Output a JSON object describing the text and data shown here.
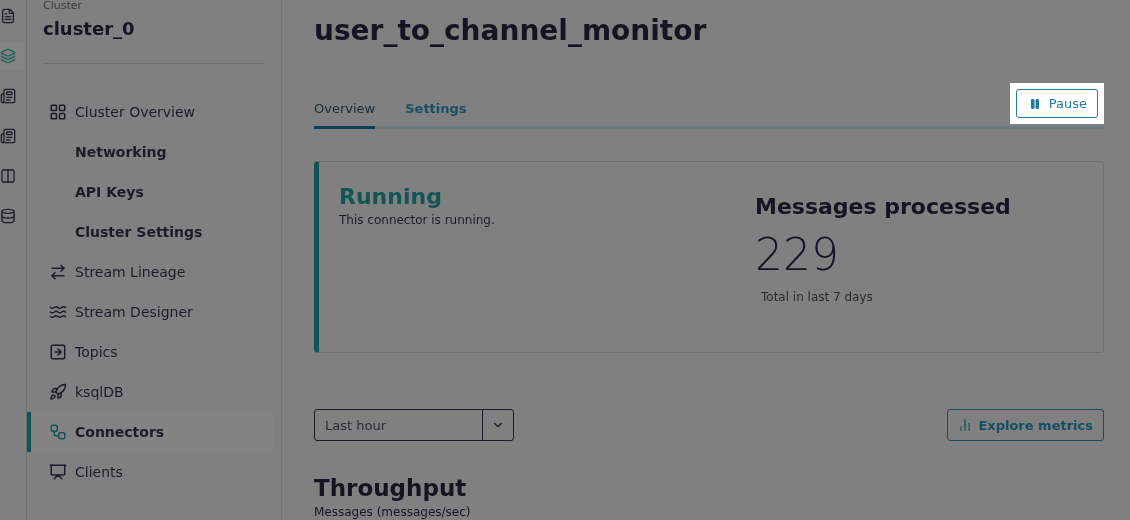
{
  "rail": {
    "items": [
      {
        "selected": false
      },
      {
        "selected": true
      },
      {
        "selected": false
      },
      {
        "selected": false
      },
      {
        "selected": false
      },
      {
        "selected": false
      }
    ]
  },
  "sidebar": {
    "label": "Cluster",
    "cluster": "cluster_0",
    "items": [
      {
        "label": "Cluster Overview",
        "kind": "main",
        "selected": false
      },
      {
        "label": "Networking",
        "kind": "sub",
        "selected": false
      },
      {
        "label": "API Keys",
        "kind": "sub",
        "selected": false
      },
      {
        "label": "Cluster Settings",
        "kind": "sub",
        "selected": false
      },
      {
        "label": "Stream Lineage",
        "kind": "main",
        "selected": false
      },
      {
        "label": "Stream Designer",
        "kind": "main",
        "selected": false
      },
      {
        "label": "Topics",
        "kind": "main",
        "selected": false
      },
      {
        "label": "ksqlDB",
        "kind": "main",
        "selected": false
      },
      {
        "label": "Connectors",
        "kind": "main",
        "selected": true
      },
      {
        "label": "Clients",
        "kind": "main",
        "selected": false
      }
    ]
  },
  "title": "user_to_channel_monitor",
  "tabs": [
    {
      "label": "Overview",
      "selected": true
    },
    {
      "label": "Settings",
      "selected": false
    }
  ],
  "pause_button": {
    "label": "Pause"
  },
  "status": {
    "title": "Running",
    "text": "This connector is running."
  },
  "messages": {
    "title": "Messages processed",
    "count": "229",
    "caption": "Total in last 7 days"
  },
  "range_select": {
    "value": "Last hour"
  },
  "explore_button": {
    "label": "Explore metrics"
  },
  "throughput": {
    "title": "Throughput",
    "subtitle": "Messages (messages/sec)"
  }
}
